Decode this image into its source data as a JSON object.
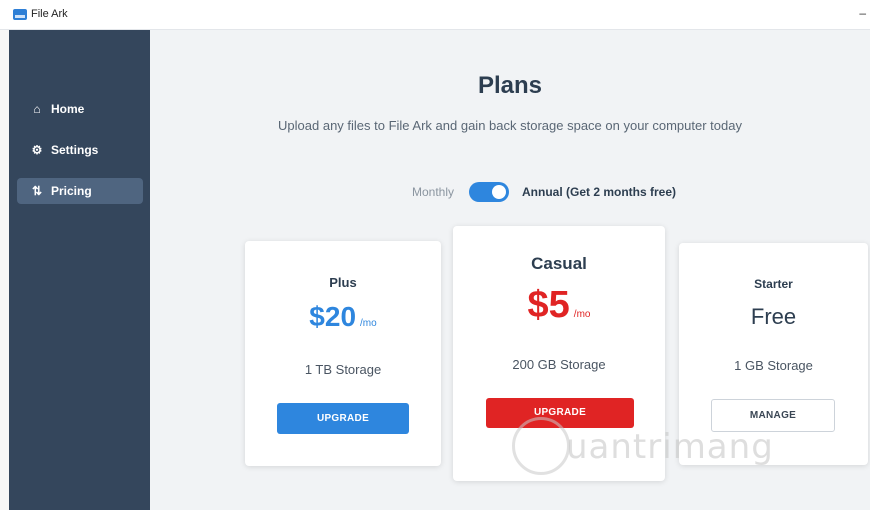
{
  "window": {
    "title": "File Ark",
    "minimize": "–"
  },
  "sidebar": {
    "items": [
      {
        "label": "Home",
        "icon": "home-icon",
        "glyph": "⌂"
      },
      {
        "label": "Settings",
        "icon": "gear-icon",
        "glyph": "⚙"
      },
      {
        "label": "Pricing",
        "icon": "sort-icon",
        "glyph": "⇅",
        "active": true
      }
    ]
  },
  "main": {
    "title": "Plans",
    "subtitle": "Upload any files to File Ark and gain back storage space on your computer today",
    "billing_toggle": {
      "monthly_label": "Monthly",
      "annual_label": "Annual (Get 2 months free)",
      "annual_selected": true
    }
  },
  "plans": [
    {
      "name": "Plus",
      "price": "$20",
      "per": "/mo",
      "storage": "1 TB Storage",
      "button": "UPGRADE",
      "price_color": "#2e86de"
    },
    {
      "name": "Casual",
      "price": "$5",
      "per": "/mo",
      "storage": "200 GB Storage",
      "button": "UPGRADE",
      "price_color": "#e02424"
    },
    {
      "name": "Starter",
      "price": "Free",
      "per": "",
      "storage": "1 GB Storage",
      "button": "MANAGE",
      "price_color": "#2d3e50"
    }
  ],
  "watermark": "uantrimang",
  "colors": {
    "sidebar": "#34465c",
    "accent_blue": "#2e86de",
    "accent_red": "#e02424"
  }
}
